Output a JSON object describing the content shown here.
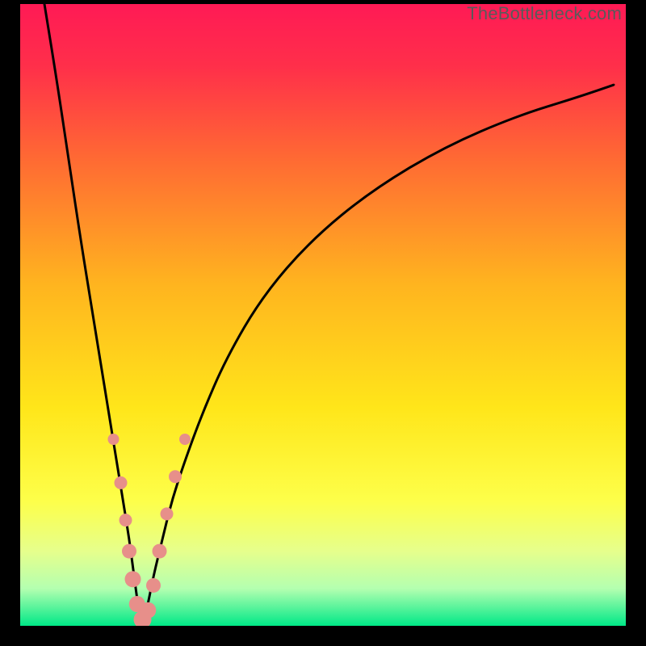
{
  "watermark": "TheBottleneck.com",
  "chart_data": {
    "type": "line",
    "title": "",
    "xlabel": "",
    "ylabel": "",
    "xlim": [
      0,
      100
    ],
    "ylim": [
      0,
      100
    ],
    "background_gradient_stops": [
      {
        "pos": 0.0,
        "color": "#ff1a55"
      },
      {
        "pos": 0.1,
        "color": "#ff2f4a"
      },
      {
        "pos": 0.25,
        "color": "#ff6a33"
      },
      {
        "pos": 0.45,
        "color": "#ffb41f"
      },
      {
        "pos": 0.65,
        "color": "#ffe61a"
      },
      {
        "pos": 0.8,
        "color": "#fdff4a"
      },
      {
        "pos": 0.88,
        "color": "#e6ff8c"
      },
      {
        "pos": 0.94,
        "color": "#b4ffb0"
      },
      {
        "pos": 1.0,
        "color": "#00e887"
      }
    ],
    "series": [
      {
        "name": "bottleneck-curve",
        "x": [
          4,
          6,
          8,
          10,
          12,
          14,
          15,
          16,
          17,
          18,
          18.8,
          19.5,
          20.2,
          21,
          22,
          23.5,
          25,
          27,
          30,
          34,
          40,
          48,
          58,
          70,
          82,
          92,
          98
        ],
        "y": [
          100,
          88,
          75,
          62,
          50,
          38,
          32,
          26,
          20,
          14,
          8,
          3,
          0.5,
          3,
          8,
          14,
          20,
          26,
          34,
          43,
          53,
          62,
          70,
          77,
          82,
          85,
          87
        ]
      }
    ],
    "markers": {
      "name": "bead-cluster",
      "color": "#e78f8a",
      "radius_range": [
        6,
        11
      ],
      "points": [
        {
          "x": 15.4,
          "y": 30.0,
          "r": 7
        },
        {
          "x": 16.6,
          "y": 23.0,
          "r": 8
        },
        {
          "x": 17.4,
          "y": 17.0,
          "r": 8
        },
        {
          "x": 18.0,
          "y": 12.0,
          "r": 9
        },
        {
          "x": 18.6,
          "y": 7.5,
          "r": 10
        },
        {
          "x": 19.3,
          "y": 3.5,
          "r": 10
        },
        {
          "x": 20.2,
          "y": 1.0,
          "r": 11
        },
        {
          "x": 21.1,
          "y": 2.5,
          "r": 10
        },
        {
          "x": 22.0,
          "y": 6.5,
          "r": 9
        },
        {
          "x": 23.0,
          "y": 12.0,
          "r": 9
        },
        {
          "x": 24.2,
          "y": 18.0,
          "r": 8
        },
        {
          "x": 25.6,
          "y": 24.0,
          "r": 8
        },
        {
          "x": 27.2,
          "y": 30.0,
          "r": 7
        }
      ]
    }
  }
}
